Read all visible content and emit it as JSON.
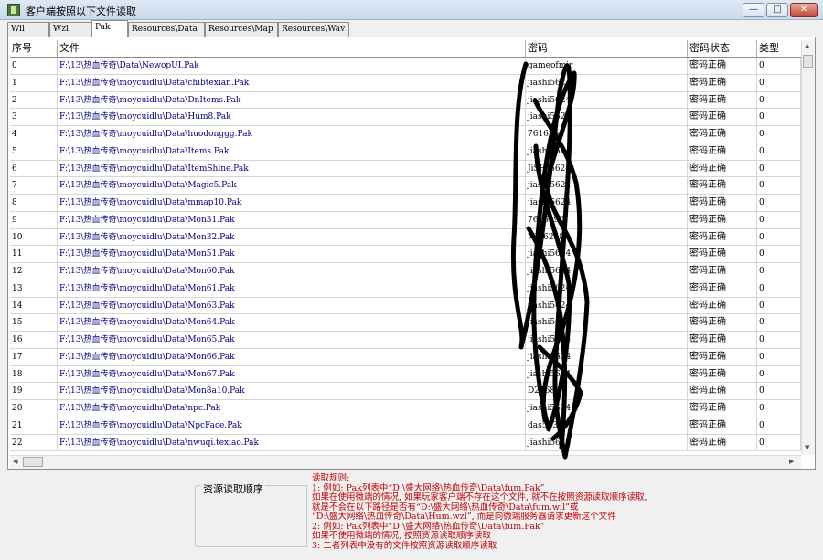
{
  "window": {
    "title": "客户端按照以下文件读取",
    "min_glyph": "—",
    "max_glyph": "□",
    "close_glyph": "✕"
  },
  "tabs": [
    {
      "label": "Wil",
      "active": false
    },
    {
      "label": "Wzl",
      "active": false
    },
    {
      "label": "Pak",
      "active": true
    },
    {
      "label": "Resources\\Data",
      "active": false
    },
    {
      "label": "Resources\\Map",
      "active": false
    },
    {
      "label": "Resources\\Wav",
      "active": false
    }
  ],
  "table": {
    "columns": {
      "id": "序号",
      "file": "文件",
      "password": "密码",
      "status": "密码状态",
      "type": "类型"
    },
    "rows": [
      {
        "id": "0",
        "file": "F:\\13\\热血传奇\\Data\\NewopUI.Pak",
        "password": "gameofmir",
        "status": "密码正确",
        "type": "0"
      },
      {
        "id": "1",
        "file": "F:\\13\\热血传奇\\moycuidlu\\Data\\chibtexian.Pak",
        "password": "jiashi5624",
        "status": "密码正确",
        "type": "0"
      },
      {
        "id": "2",
        "file": "F:\\13\\热血传奇\\moycuidlu\\Data\\DnItems.Pak",
        "password": "jiashi5624",
        "status": "密码正确",
        "type": "0"
      },
      {
        "id": "3",
        "file": "F:\\13\\热血传奇\\moycuidlu\\Data\\Hum8.Pak",
        "password": "jiashi5624",
        "status": "密码正确",
        "type": "0"
      },
      {
        "id": "4",
        "file": "F:\\13\\热血传奇\\moycuidlu\\Data\\huodonggg.Pak",
        "password": "7616258",
        "status": "密码正确",
        "type": "0"
      },
      {
        "id": "5",
        "file": "F:\\13\\热血传奇\\moycuidlu\\Data\\Items.Pak",
        "password": "jiashi5624",
        "status": "密码正确",
        "type": "0"
      },
      {
        "id": "6",
        "file": "F:\\13\\热血传奇\\moycuidlu\\Data\\ItemShine.Pak",
        "password": "JiSHJ5624",
        "status": "密码正确",
        "type": "0"
      },
      {
        "id": "7",
        "file": "F:\\13\\热血传奇\\moycuidlu\\Data\\Magic5.Pak",
        "password": "jiashi5624",
        "status": "密码正确",
        "type": "0"
      },
      {
        "id": "8",
        "file": "F:\\13\\热血传奇\\moycuidlu\\Data\\mmap10.Pak",
        "password": "jiashi5624",
        "status": "密码正确",
        "type": "0"
      },
      {
        "id": "9",
        "file": "F:\\13\\热血传奇\\moycuidlu\\Data\\Mon31.Pak",
        "password": "7616290",
        "status": "密码正确",
        "type": "0"
      },
      {
        "id": "10",
        "file": "F:\\13\\热血传奇\\moycuidlu\\Data\\Mon32.Pak",
        "password": "7616258",
        "status": "密码正确",
        "type": "0"
      },
      {
        "id": "11",
        "file": "F:\\13\\热血传奇\\moycuidlu\\Data\\Mon51.Pak",
        "password": "jiashi5624",
        "status": "密码正确",
        "type": "0"
      },
      {
        "id": "12",
        "file": "F:\\13\\热血传奇\\moycuidlu\\Data\\Mon60.Pak",
        "password": "jiashi5624",
        "status": "密码正确",
        "type": "0"
      },
      {
        "id": "13",
        "file": "F:\\13\\热血传奇\\moycuidlu\\Data\\Mon61.Pak",
        "password": "jiashi5624",
        "status": "密码正确",
        "type": "0"
      },
      {
        "id": "14",
        "file": "F:\\13\\热血传奇\\moycuidlu\\Data\\Mon63.Pak",
        "password": "jiashi5624",
        "status": "密码正确",
        "type": "0"
      },
      {
        "id": "15",
        "file": "F:\\13\\热血传奇\\moycuidlu\\Data\\Mon64.Pak",
        "password": "jiashi5624",
        "status": "密码正确",
        "type": "0"
      },
      {
        "id": "16",
        "file": "F:\\13\\热血传奇\\moycuidlu\\Data\\Mon65.Pak",
        "password": "jiashi5624",
        "status": "密码正确",
        "type": "0"
      },
      {
        "id": "17",
        "file": "F:\\13\\热血传奇\\moycuidlu\\Data\\Mon66.Pak",
        "password": "jiashi5624",
        "status": "密码正确",
        "type": "0"
      },
      {
        "id": "18",
        "file": "F:\\13\\热血传奇\\moycuidlu\\Data\\Mon67.Pak",
        "password": "jiashi5624",
        "status": "密码正确",
        "type": "0"
      },
      {
        "id": "19",
        "file": "F:\\13\\热血传奇\\moycuidlu\\Data\\Mon8a10.Pak",
        "password": "D2468",
        "status": "密码正确",
        "type": "0"
      },
      {
        "id": "20",
        "file": "F:\\13\\热血传奇\\moycuidlu\\Data\\npc.Pak",
        "password": "jiashi5624",
        "status": "密码正确",
        "type": "0"
      },
      {
        "id": "21",
        "file": "F:\\13\\热血传奇\\moycuidlu\\Data\\NpcFace.Pak",
        "password": "das5637",
        "status": "密码正确",
        "type": "0"
      },
      {
        "id": "22",
        "file": "F:\\13\\热血传奇\\moycuidlu\\Data\\nwuqi.texiao.Pak",
        "password": "jiashi5624",
        "status": "密码正确",
        "type": "0"
      }
    ]
  },
  "group": {
    "title": "资源读取顺序"
  },
  "rules": {
    "heading": "读取规则:",
    "lines": [
      "1: 例如: Pak列表中“D:\\盛大网络\\热血传奇\\Data\\fum.Pak”",
      "   如果在使用微端的情况, 如果玩家客户端不存在这个文件, 就不在按照资源读取顺序读取,",
      "   就是不会在以下路径是否有“D:\\盛大网络\\热血传奇\\Data\\fum.wil”或",
      "   “D:\\盛大网络\\热血传奇\\Data\\Hum.wzl”, 而是向微端服务器请求更新这个文件",
      "2: 例如: Pak列表中“D:\\盛大网络\\热血传奇\\Data\\fum.Pak”",
      "   如果不使用微端的情况, 按照资源读取顺序读取",
      "3: 二者列表中没有的文件按照资源读取顺序读取"
    ]
  }
}
